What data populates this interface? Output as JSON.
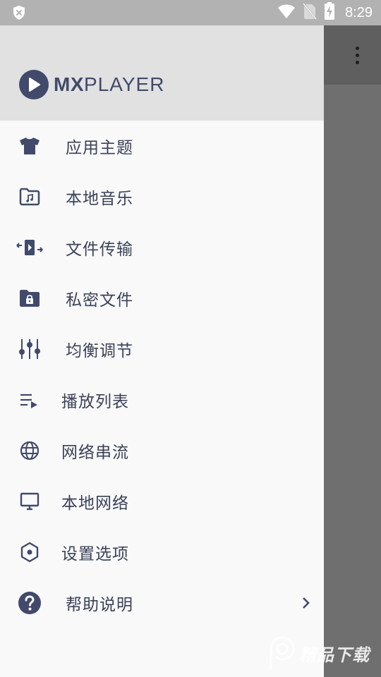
{
  "status_bar": {
    "time": "8:29",
    "icons": [
      "shield-x-icon",
      "wifi-icon",
      "no-sim-icon",
      "battery-charging-icon"
    ]
  },
  "app_bar": {
    "overflow_icon": "more-vert-icon"
  },
  "drawer": {
    "logo": {
      "mx": "MX",
      "player": "PLAYER",
      "brand_color": "#414a6b"
    },
    "items": [
      {
        "label": "应用主题",
        "icon": "tshirt-icon"
      },
      {
        "label": "本地音乐",
        "icon": "music-folder-icon"
      },
      {
        "label": "文件传输",
        "icon": "file-transfer-icon"
      },
      {
        "label": "私密文件",
        "icon": "lock-folder-icon"
      },
      {
        "label": "均衡调节",
        "icon": "equalizer-icon"
      },
      {
        "label": "播放列表",
        "icon": "playlist-icon"
      },
      {
        "label": "网络串流",
        "icon": "globe-icon"
      },
      {
        "label": "本地网络",
        "icon": "monitor-icon"
      },
      {
        "label": "设置选项",
        "icon": "hex-settings-icon"
      },
      {
        "label": "帮助说明",
        "icon": "help-circle-icon"
      }
    ]
  },
  "watermark": {
    "text": "精品下载"
  },
  "colors": {
    "drawer_bg": "#f9f9fa",
    "header_bg": "#e1e1e1",
    "icon_color": "#414a6b",
    "text_color": "#3b4157",
    "scrim": "#6f6f6f"
  }
}
